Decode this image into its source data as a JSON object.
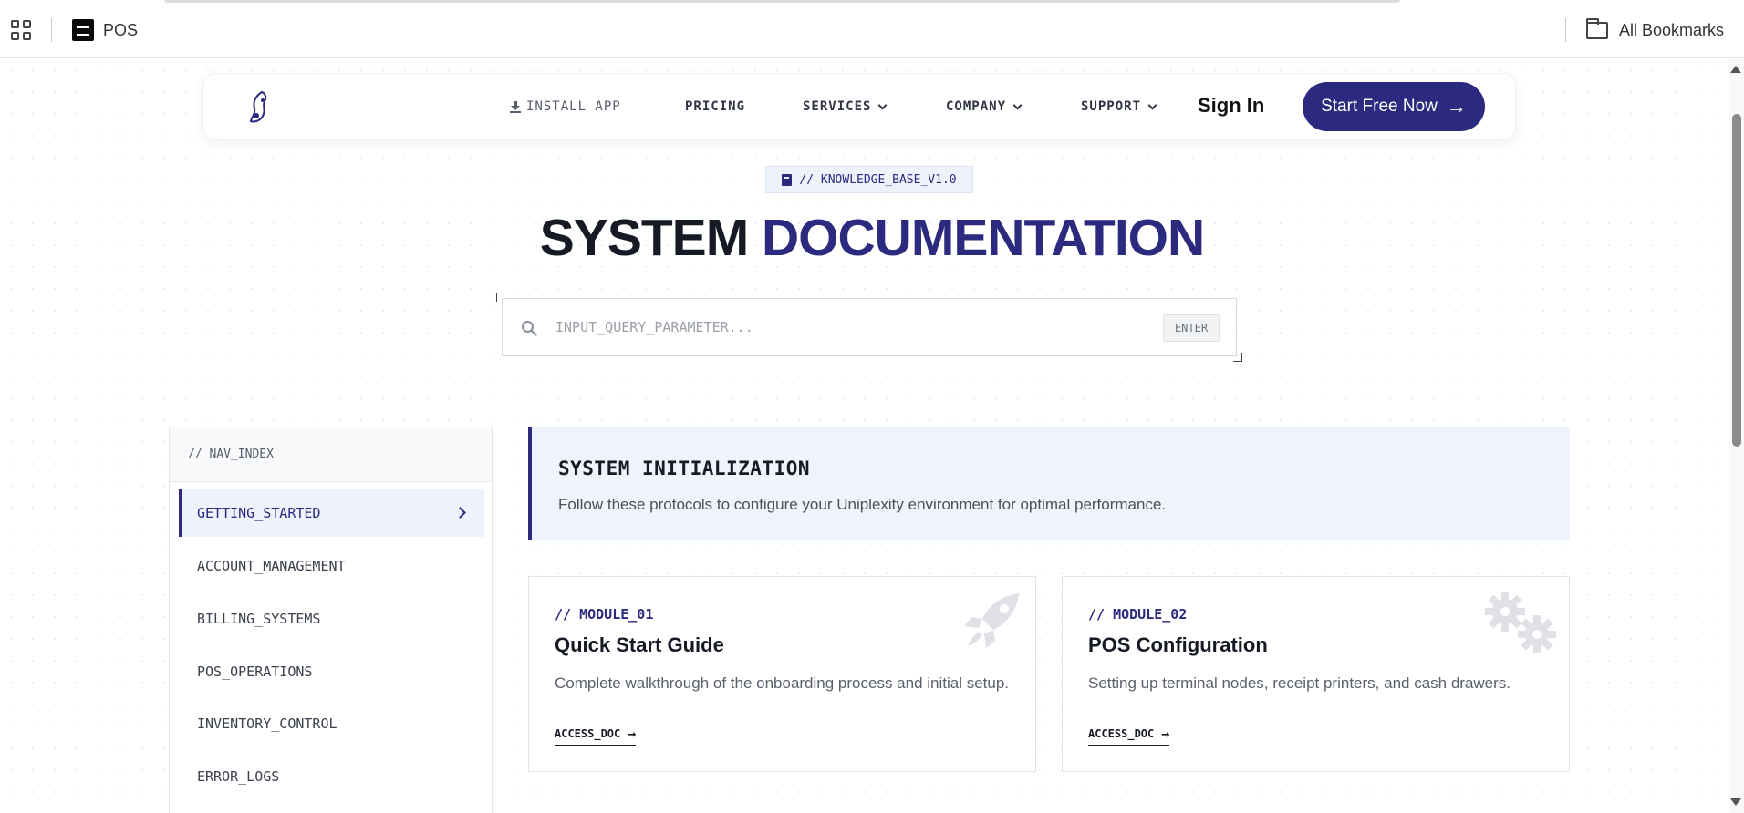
{
  "browser": {
    "bookmark_label": "POS",
    "all_bookmarks_label": "All Bookmarks"
  },
  "nav": {
    "install_app": "INSTALL APP",
    "pricing": "PRICING",
    "services": "SERVICES",
    "company": "COMPANY",
    "support": "SUPPORT",
    "sign_in": "Sign In",
    "cta": "Start Free Now",
    "cta_arrow": "→"
  },
  "hero": {
    "tag": "// KNOWLEDGE_BASE_V1.0",
    "title_part1": "SYSTEM",
    "title_part2": "DOCUMENTATION",
    "search_placeholder": "INPUT_QUERY_PARAMETER...",
    "search_value": "",
    "enter_label": "ENTER"
  },
  "sidebar": {
    "header": "// NAV_INDEX",
    "items": [
      {
        "label": "GETTING_STARTED",
        "active": true
      },
      {
        "label": "ACCOUNT_MANAGEMENT",
        "active": false
      },
      {
        "label": "BILLING_SYSTEMS",
        "active": false
      },
      {
        "label": "POS_OPERATIONS",
        "active": false
      },
      {
        "label": "INVENTORY_CONTROL",
        "active": false
      },
      {
        "label": "ERROR_LOGS",
        "active": false
      }
    ]
  },
  "main": {
    "init_title": "SYSTEM INITIALIZATION",
    "init_desc": "Follow these protocols to configure your Uniplexity environment for optimal performance.",
    "cards": [
      {
        "module": "// MODULE_01",
        "title": "Quick Start Guide",
        "desc": "Complete walkthrough of the onboarding process and initial setup.",
        "link": "ACCESS_DOC",
        "icon": "rocket-icon"
      },
      {
        "module": "// MODULE_02",
        "title": "POS Configuration",
        "desc": "Setting up terminal nodes, receipt printers, and cash drawers.",
        "link": "ACCESS_DOC",
        "icon": "gears-icon"
      }
    ]
  },
  "colors": {
    "brand": "#2b2a7f",
    "heading": "#161a24",
    "info_bg": "#eef3fd"
  }
}
